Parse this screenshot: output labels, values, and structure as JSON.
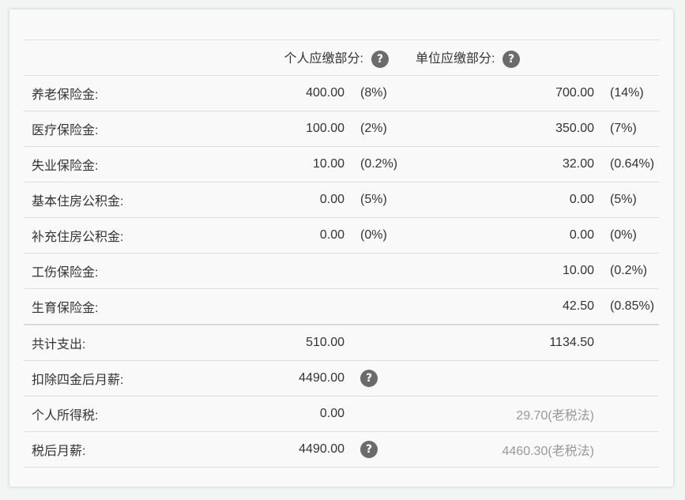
{
  "header": {
    "personal_label": "个人应缴部分:",
    "company_label": "单位应缴部分:",
    "help_icon": "?"
  },
  "rows": [
    {
      "label": "养老保险金:",
      "personal": "400.00",
      "personal_pct": "(8%)",
      "company": "700.00",
      "company_pct": "(14%)"
    },
    {
      "label": "医疗保险金:",
      "personal": "100.00",
      "personal_pct": "(2%)",
      "company": "350.00",
      "company_pct": "(7%)"
    },
    {
      "label": "失业保险金:",
      "personal": "10.00",
      "personal_pct": "(0.2%)",
      "company": "32.00",
      "company_pct": "(0.64%)"
    },
    {
      "label": "基本住房公积金:",
      "personal": "0.00",
      "personal_pct": "(5%)",
      "company": "0.00",
      "company_pct": "(5%)"
    },
    {
      "label": "补充住房公积金:",
      "personal": "0.00",
      "personal_pct": "(0%)",
      "company": "0.00",
      "company_pct": "(0%)"
    },
    {
      "label": "工伤保险金:",
      "personal": "",
      "personal_pct": "",
      "company": "10.00",
      "company_pct": "(0.2%)"
    },
    {
      "label": "生育保险金:",
      "personal": "",
      "personal_pct": "",
      "company": "42.50",
      "company_pct": "(0.85%)"
    }
  ],
  "summary": {
    "total": {
      "label": "共计支出:",
      "personal": "510.00",
      "company": "1134.50"
    },
    "after_deduction": {
      "label": "扣除四金后月薪:",
      "personal": "4490.00"
    },
    "income_tax": {
      "label": "个人所得税:",
      "personal": "0.00",
      "company": "29.70(老税法)"
    },
    "net_salary": {
      "label": "税后月薪:",
      "personal": "4490.00",
      "company": "4460.30(老税法)"
    }
  },
  "colors": {
    "help_icon_bg": "#6b6b6b",
    "muted_text": "#999999",
    "border": "#dedede"
  }
}
